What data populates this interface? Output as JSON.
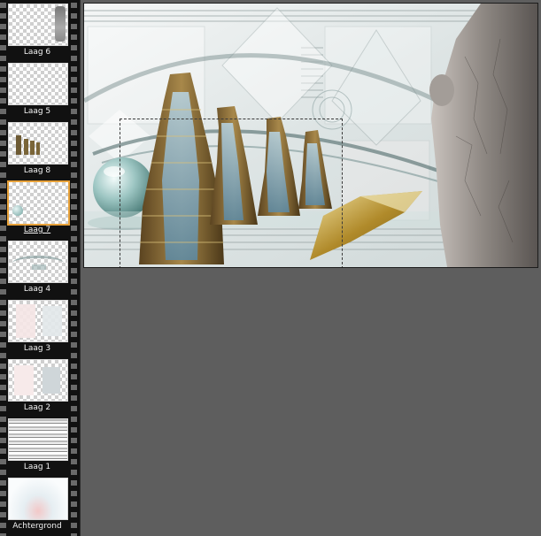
{
  "layers": [
    {
      "name": "Laag 6",
      "selected": false
    },
    {
      "name": "Laag 5",
      "selected": false
    },
    {
      "name": "Laag 8",
      "selected": false
    },
    {
      "name": "Laag 7",
      "selected": true
    },
    {
      "name": "Laag 4",
      "selected": false
    },
    {
      "name": "Laag 3",
      "selected": false
    },
    {
      "name": "Laag 2",
      "selected": false
    },
    {
      "name": "Laag 1",
      "selected": false
    },
    {
      "name": "Achtergrond",
      "selected": false
    }
  ],
  "colors": {
    "workspace": "#5e5e5e",
    "strip": "#111111",
    "selection_accent": "#e8a23a",
    "label_text": "#f2f2f2"
  },
  "canvas": {
    "content": "artwork"
  }
}
